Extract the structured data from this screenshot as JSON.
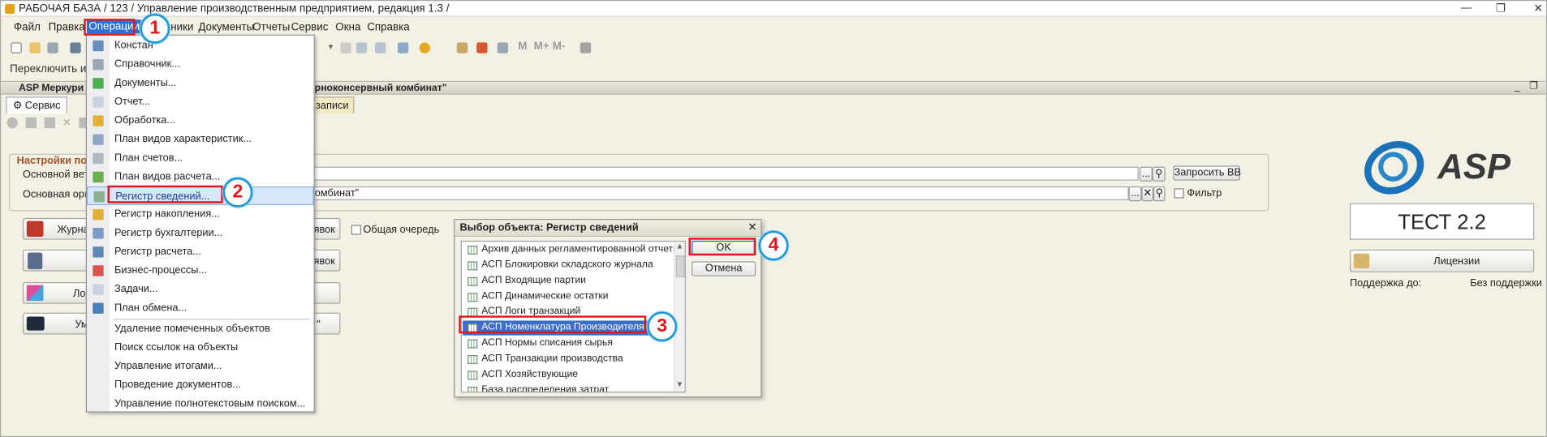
{
  "window": {
    "title": "РАБОЧАЯ БАЗА / 123 / Управление производственным предприятием, редакция 1.3 /"
  },
  "menubar": {
    "items": [
      "Файл",
      "Правка",
      "Операции",
      "Справочники",
      "Документы",
      "Отчеты",
      "Сервис",
      "Окна",
      "Справка"
    ],
    "visible_fragment": "ники"
  },
  "row3": {
    "text": "Переключить инте"
  },
  "app_header": {
    "title_left": "ASP Меркури",
    "title_right": "рноконсервный комбинат\""
  },
  "tabs": {
    "service": "Сервис",
    "records": "записи"
  },
  "settings": {
    "title": "Настройки по",
    "row1_label": "Основной вет в",
    "row2_label": "Основная орга",
    "row2_value": "омбинат\"",
    "request_button": "Запросить ВВ",
    "filter_label": "Фильтр",
    "ellipsis": "...",
    "clear": "✕"
  },
  "left_buttons": [
    {
      "label": "Журна",
      "suffix": "явок"
    },
    {
      "label": "",
      "suffix": "явок"
    },
    {
      "label": "Ло",
      "suffix": ""
    },
    {
      "label": "Ум",
      "suffix": "\""
    }
  ],
  "common_queue": "Общая очередь",
  "operations_menu": {
    "items": [
      "Констан",
      "Справочник...",
      "Документы...",
      "Отчет...",
      "Обработка...",
      "План видов характеристик...",
      "План счетов...",
      "План видов расчета...",
      "Регистр сведений...",
      "Регистр накопления...",
      "Регистр бухгалтерии...",
      "Регистр расчета...",
      "Бизнес-процессы...",
      "Задачи...",
      "План обмена..."
    ],
    "items2": [
      "Удаление помеченных объектов",
      "Поиск ссылок на объекты",
      "Управление итогами...",
      "Проведение документов...",
      "Управление полнотекстовым поиском..."
    ]
  },
  "dialog": {
    "title": "Выбор объекта: Регистр сведений",
    "items": [
      "Архив данных регламентированной отчетно",
      "АСП Блокировки складского журнала",
      "АСП Входящие партии",
      "АСП Динамические остатки",
      "АСП Логи транзакций",
      "АСП Номенклатура Производителя",
      "АСП Нормы списания сырья",
      "АСП Транзакции производства",
      "АСП Хозяйствующие",
      "База распределения затрат"
    ],
    "selected_index": 5,
    "ok": "OK",
    "cancel": "Отмена",
    "close": "✕"
  },
  "brand": {
    "logo_text": "ASP",
    "test_label": "ТЕСТ 2.2",
    "licenses": "Лицензии",
    "support_label": "Поддержка до:",
    "support_value": "Без поддержки"
  },
  "markers": [
    "1",
    "2",
    "3",
    "4"
  ],
  "colors": {
    "accent": "#2c6fd5",
    "highlight": "#e0191d",
    "marker_ring": "#1997d8",
    "selection": "#3b6ec6",
    "logo_blue": "#1a73b9"
  }
}
